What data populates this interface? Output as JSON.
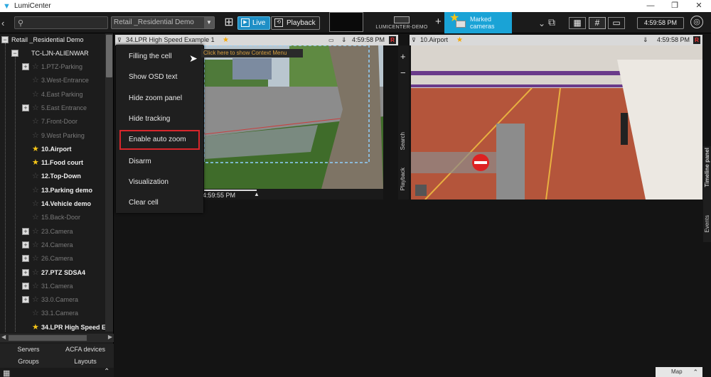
{
  "app": {
    "title": "LumiCenter",
    "win_minimize": "—",
    "win_restore": "❐",
    "win_close": "✕"
  },
  "toolbar": {
    "back_icon": "‹",
    "search_placeholder": "",
    "site_select": "Retail _Residential Demo",
    "live_label": "Live",
    "playback_label": "Playback",
    "server_label": "LUMICENTER-DEMO",
    "add_label": "+",
    "marked_cameras_line1": "Marked",
    "marked_cameras_line2": "cameras",
    "clock": "4:59:58 PM",
    "layout_icons": [
      "▦",
      "#",
      "▭"
    ]
  },
  "sidebar": {
    "site": "Retail _Residential Demo",
    "server": "TC-LJN-ALIENWAR",
    "items": [
      {
        "label": "1.PTZ-Parking",
        "expand": true,
        "starred": false,
        "active": false
      },
      {
        "label": "3.West-Entrance",
        "expand": false,
        "starred": false,
        "active": false
      },
      {
        "label": "4.East Parking",
        "expand": false,
        "starred": false,
        "active": false
      },
      {
        "label": "5.East Entrance",
        "expand": true,
        "starred": false,
        "active": false
      },
      {
        "label": "7.Front-Door",
        "expand": false,
        "starred": false,
        "active": false
      },
      {
        "label": "9.West Parking",
        "expand": false,
        "starred": false,
        "active": false
      },
      {
        "label": "10.Airport",
        "expand": false,
        "starred": true,
        "active": true
      },
      {
        "label": "11.Food court",
        "expand": false,
        "starred": true,
        "active": true
      },
      {
        "label": "12.Top-Down",
        "expand": false,
        "starred": false,
        "active": true
      },
      {
        "label": "13.Parking demo",
        "expand": false,
        "starred": false,
        "active": true
      },
      {
        "label": "14.Vehicle demo",
        "expand": false,
        "starred": false,
        "active": true
      },
      {
        "label": "15.Back-Door",
        "expand": false,
        "starred": false,
        "active": false
      },
      {
        "label": "23.Camera",
        "expand": true,
        "starred": false,
        "active": false
      },
      {
        "label": "24.Camera",
        "expand": true,
        "starred": false,
        "active": false
      },
      {
        "label": "26.Camera",
        "expand": true,
        "starred": false,
        "active": false
      },
      {
        "label": "27.PTZ SDSA4",
        "expand": true,
        "starred": false,
        "active": true
      },
      {
        "label": "31.Camera",
        "expand": true,
        "starred": false,
        "active": false
      },
      {
        "label": "33.0.Camera",
        "expand": true,
        "starred": false,
        "active": false
      },
      {
        "label": "33.1.Camera",
        "expand": false,
        "starred": false,
        "active": false
      },
      {
        "label": "34.LPR High Speed E",
        "expand": false,
        "starred": true,
        "active": true
      }
    ],
    "tabs": [
      "Servers",
      "ACFA devices",
      "Groups",
      "Layouts"
    ]
  },
  "panel1": {
    "title": "34.LPR High Speed Example 1",
    "time": "4:59:58 PM",
    "rec": "R",
    "timeline_time": "4:59:55 PM"
  },
  "panel2": {
    "title": "10.Airport",
    "time": "4:59:58 PM",
    "rec": "R"
  },
  "tooltip": "Click here to show Context Menu",
  "context_menu": [
    "Filling the cell",
    "Show OSD text",
    "Hide zoom panel",
    "Hide tracking",
    "Enable auto zoom",
    "Disarm",
    "Visualization",
    "Clear cell"
  ],
  "side_labels": {
    "search": "Search",
    "playback": "Playback",
    "timeline": "Timeline panel",
    "events": "Events"
  },
  "map_label": "Map",
  "colors": {
    "accent": "#1aa3d6",
    "highlight": "#d8262b",
    "star": "#f5c518"
  }
}
